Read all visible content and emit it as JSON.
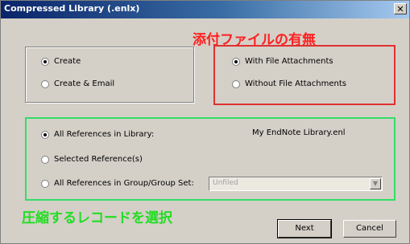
{
  "window": {
    "title": "Compressed Library (.enlx)",
    "close_glyph": "✕"
  },
  "annotations": {
    "attachments_jp": "添付ファイルの有無",
    "attachments_jp_color": "#ff2020",
    "records_jp": "圧縮するレコードを選択",
    "records_jp_color": "#22dd22"
  },
  "create_group": {
    "options": [
      {
        "label": "Create",
        "checked": true
      },
      {
        "label": "Create & Email",
        "checked": false
      }
    ]
  },
  "attachment_group": {
    "border_color": "#e03030",
    "options": [
      {
        "label": "With File Attachments",
        "checked": true
      },
      {
        "label": "Without File Attachments",
        "checked": false
      }
    ]
  },
  "reference_group": {
    "border_color": "#33dd66",
    "options": [
      {
        "label": "All References in Library:",
        "checked": true
      },
      {
        "label": "Selected Reference(s)",
        "checked": false
      },
      {
        "label": "All References in Group/Group Set:",
        "checked": false
      }
    ],
    "library_name": "My EndNote Library.enl",
    "group_select_value": "Unfiled"
  },
  "buttons": {
    "next": "Next",
    "cancel": "Cancel"
  }
}
